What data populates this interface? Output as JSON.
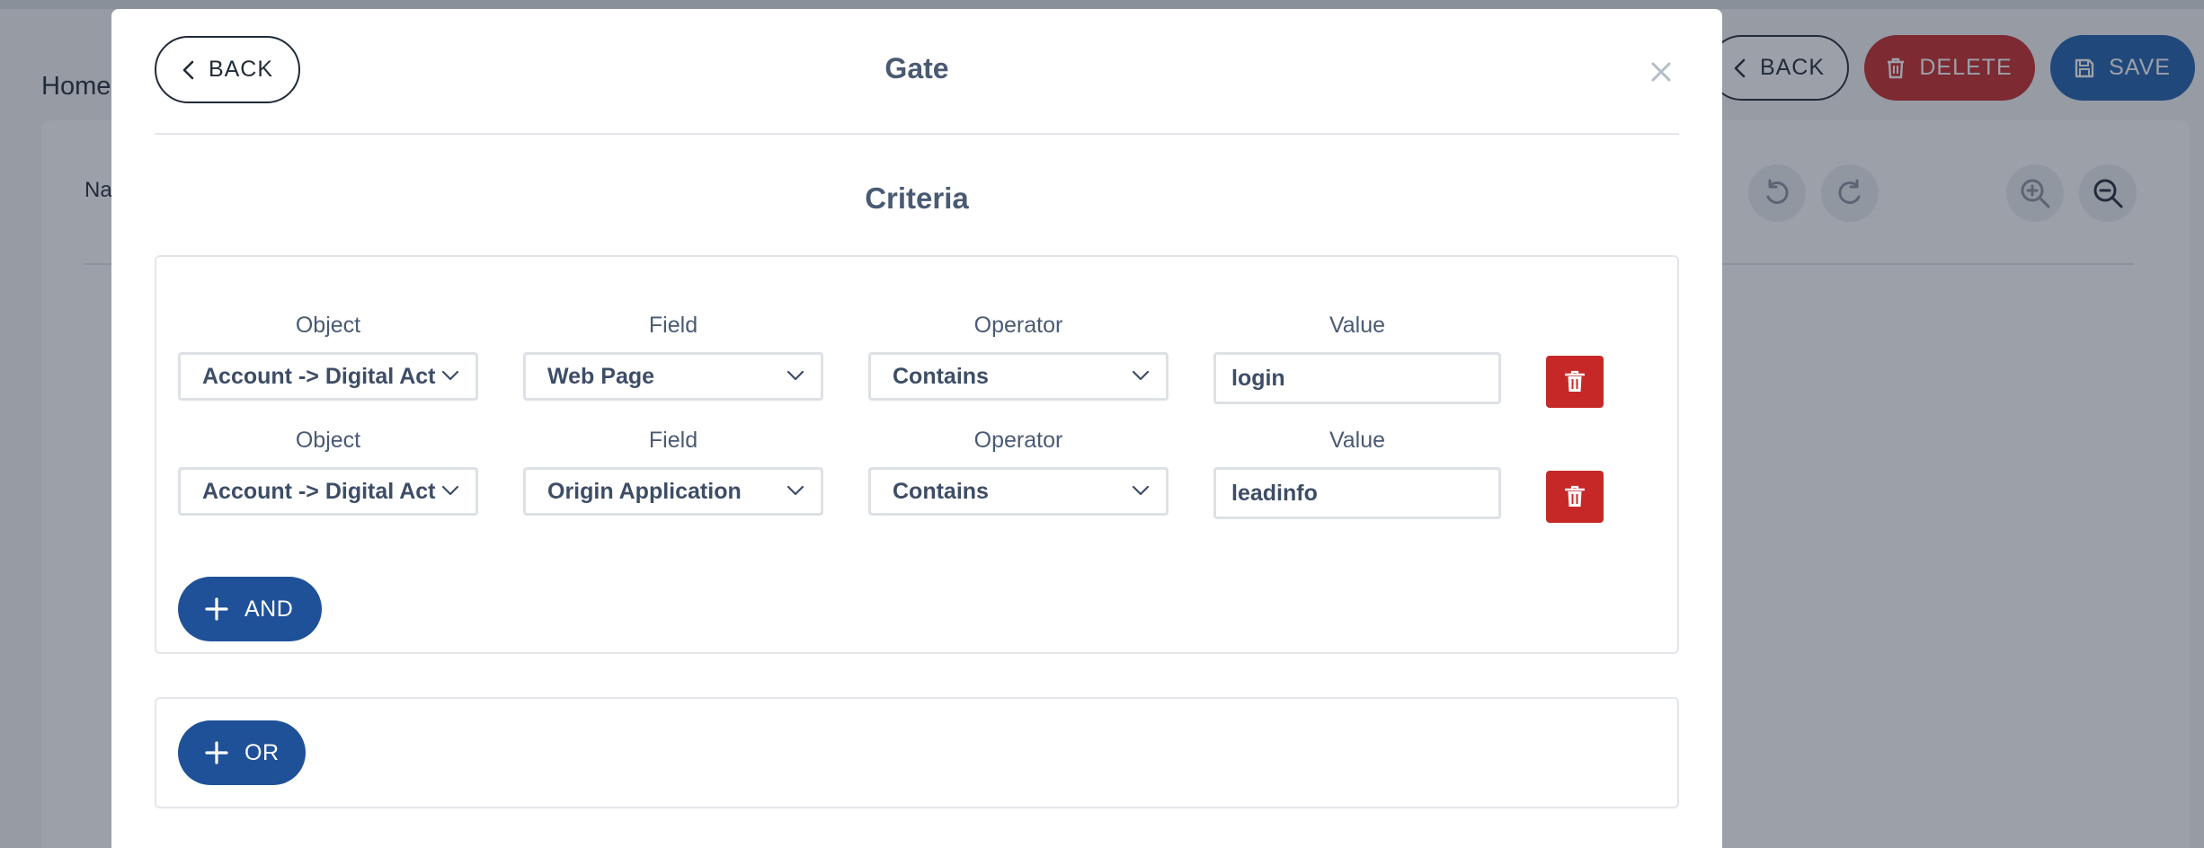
{
  "background": {
    "breadcrumb_home": "Home",
    "name_label_fragment": "Na",
    "buttons": {
      "back": "BACK",
      "delete": "DELETE",
      "save": "SAVE"
    }
  },
  "modal": {
    "back_label": "BACK",
    "title": "Gate",
    "close_icon": "close-icon",
    "section_title": "Criteria",
    "column_labels": {
      "object": "Object",
      "field": "Field",
      "operator": "Operator",
      "value": "Value"
    },
    "criteria": [
      {
        "object": "Account -> Digital Act",
        "field": "Web Page",
        "operator": "Contains",
        "value": "login"
      },
      {
        "object": "Account -> Digital Act",
        "field": "Origin Application",
        "operator": "Contains",
        "value": "leadinfo"
      }
    ],
    "and_label": "AND",
    "or_label": "OR"
  },
  "colors": {
    "primary": "#1f5199",
    "danger": "#c62828",
    "text_muted": "#4a5a73",
    "border": "#dde1e6"
  }
}
